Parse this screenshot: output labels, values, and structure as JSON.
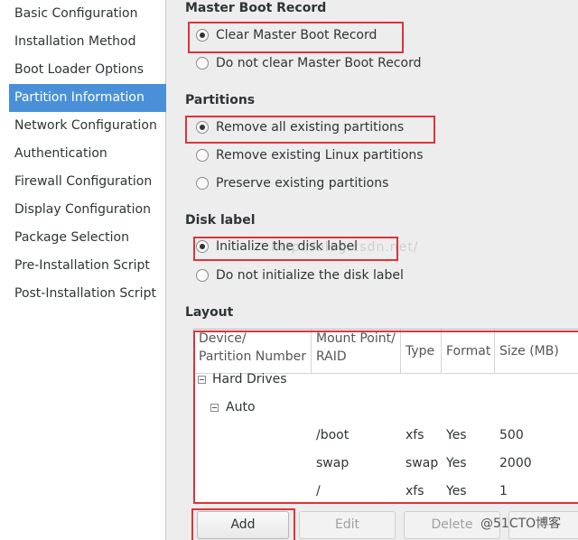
{
  "sidebar": {
    "items": [
      {
        "label": "Basic Configuration",
        "selected": false
      },
      {
        "label": "Installation Method",
        "selected": false
      },
      {
        "label": "Boot Loader Options",
        "selected": false
      },
      {
        "label": "Partition Information",
        "selected": true
      },
      {
        "label": "Network Configuration",
        "selected": false
      },
      {
        "label": "Authentication",
        "selected": false
      },
      {
        "label": "Firewall Configuration",
        "selected": false
      },
      {
        "label": "Display Configuration",
        "selected": false
      },
      {
        "label": "Package Selection",
        "selected": false
      },
      {
        "label": "Pre-Installation Script",
        "selected": false
      },
      {
        "label": "Post-Installation Script",
        "selected": false
      }
    ]
  },
  "mbr": {
    "title": "Master Boot Record",
    "options": [
      {
        "label": "Clear Master Boot Record",
        "checked": true
      },
      {
        "label": "Do not clear Master Boot Record",
        "checked": false
      }
    ]
  },
  "partitions": {
    "title": "Partitions",
    "options": [
      {
        "label": "Remove all existing partitions",
        "checked": true
      },
      {
        "label": "Remove existing Linux partitions",
        "checked": false
      },
      {
        "label": "Preserve existing partitions",
        "checked": false
      }
    ]
  },
  "disklabel": {
    "title": "Disk label",
    "options": [
      {
        "label": "Initialize the disk label",
        "checked": true
      },
      {
        "label": "Do not initialize the disk label",
        "checked": false
      }
    ]
  },
  "layout": {
    "title": "Layout",
    "columns": {
      "device_l1": "Device/",
      "device_l2": "Partition Number",
      "mount_l1": "Mount Point/",
      "mount_l2": "RAID",
      "type": "Type",
      "format": "Format",
      "size": "Size (MB)"
    },
    "tree": {
      "root": "Hard Drives",
      "child": "Auto",
      "rows": [
        {
          "mount": "/boot",
          "type": "xfs",
          "format": "Yes",
          "size": "500"
        },
        {
          "mount": "swap",
          "type": "swap",
          "format": "Yes",
          "size": "2000"
        },
        {
          "mount": "/",
          "type": "xfs",
          "format": "Yes",
          "size": "1"
        }
      ]
    }
  },
  "buttons": {
    "add": "Add",
    "edit": "Edit",
    "delete": "Delete"
  },
  "overlay": {
    "watermark": "http://blog.csdn.net/",
    "brand": "@51CTO博客"
  },
  "colors": {
    "selection": "#4a90d9",
    "annotation": "#e0323a"
  }
}
